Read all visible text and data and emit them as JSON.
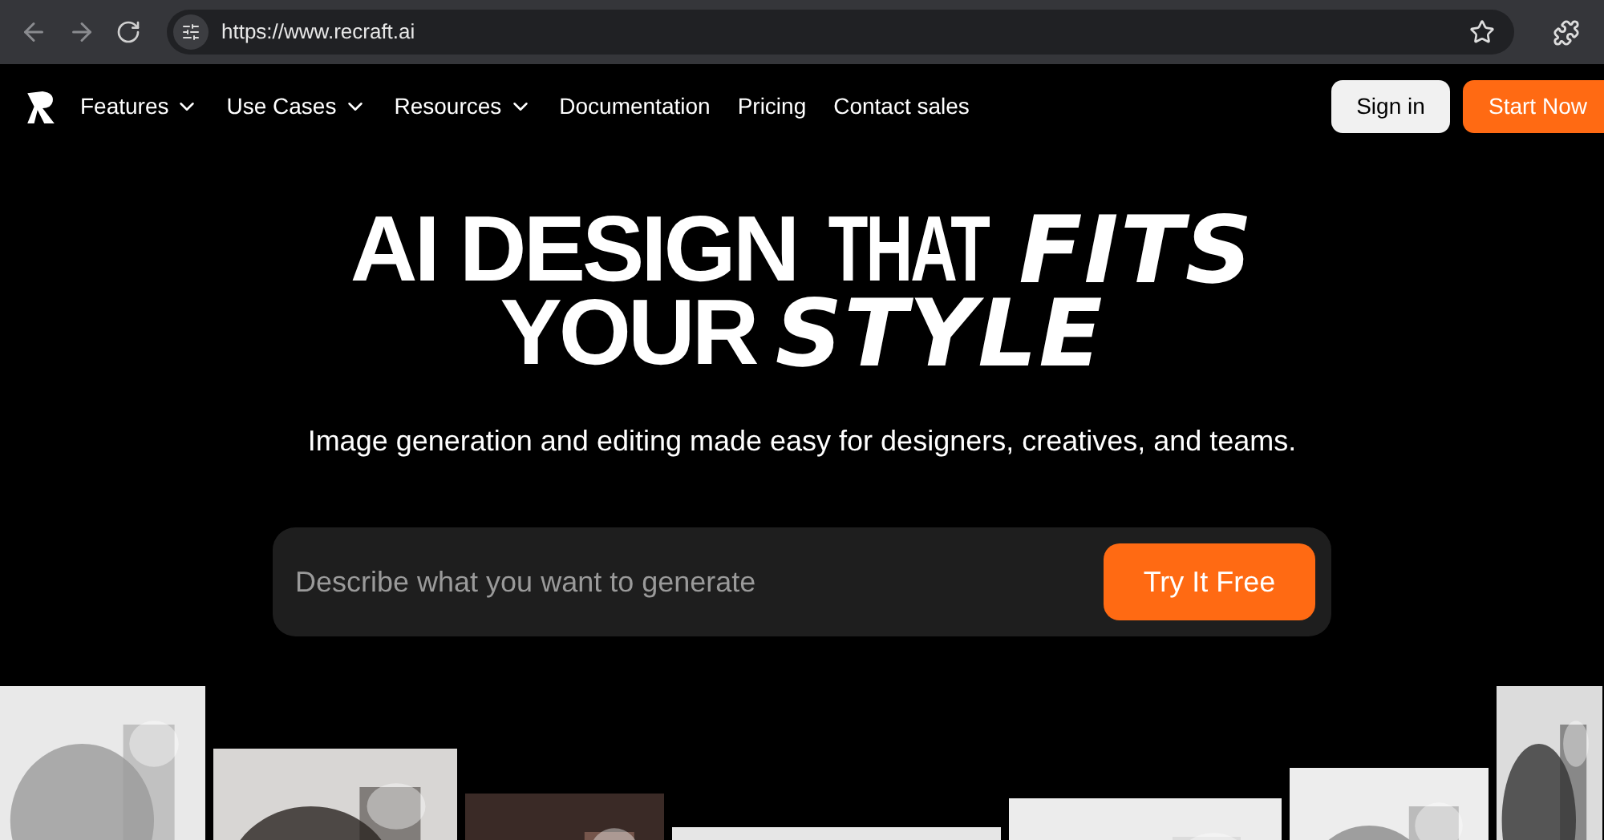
{
  "browser": {
    "url": "https://www.recraft.ai"
  },
  "nav": {
    "items": [
      {
        "label": "Features",
        "dropdown": true
      },
      {
        "label": "Use Cases",
        "dropdown": true
      },
      {
        "label": "Resources",
        "dropdown": true
      },
      {
        "label": "Documentation",
        "dropdown": false
      },
      {
        "label": "Pricing",
        "dropdown": false
      },
      {
        "label": "Contact sales",
        "dropdown": false
      }
    ],
    "sign_in": "Sign in",
    "start": "Start Now"
  },
  "hero": {
    "headline": [
      [
        {
          "text": "AI DESIGN",
          "kind": "bold"
        },
        {
          "text": "THAT",
          "kind": "condensed"
        },
        {
          "text": "FITS",
          "kind": "italic"
        }
      ],
      [
        {
          "text": "YOUR",
          "kind": "bold"
        },
        {
          "text": "STYLE",
          "kind": "italic"
        }
      ]
    ],
    "subtitle": "Image generation and editing made easy for designers, creatives, and teams.",
    "prompt": {
      "placeholder": "Describe what you want to generate",
      "button": "Try It Free"
    }
  }
}
